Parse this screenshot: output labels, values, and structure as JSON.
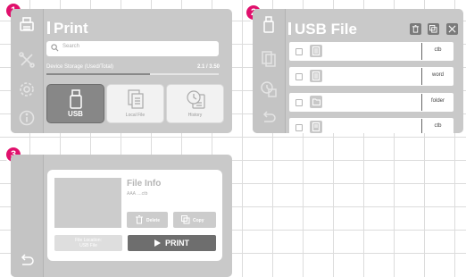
{
  "badges": [
    "1",
    "2",
    "3"
  ],
  "print_screen": {
    "title": "Print",
    "search_placeholder": "Search",
    "storage_label": "Device Storage (Used/Total)",
    "storage_value": "2.1 / 3.50",
    "storage_used_fraction": 0.6,
    "tiles": [
      {
        "label": "USB",
        "icon": "usb-drive-icon",
        "active": true
      },
      {
        "label": "Local File",
        "icon": "document-icon",
        "active": false
      },
      {
        "label": "History",
        "icon": "history-clock-icon",
        "active": false
      }
    ]
  },
  "usb_screen": {
    "title": "USB File",
    "header_icons": [
      "trash-icon",
      "copy-icon",
      "close-icon"
    ],
    "rows": [
      {
        "icon": "document-icon",
        "ext": "ctb"
      },
      {
        "icon": "document-icon",
        "ext": "word"
      },
      {
        "icon": "folder-icon",
        "ext": "folder"
      },
      {
        "icon": "document-icon",
        "ext": "ctb"
      }
    ]
  },
  "file_info_screen": {
    "title": "File Info",
    "file_name": "AAA ....ctb",
    "delete_label": "Delete",
    "copy_label": "Copy",
    "file_location_line1": "File Location:",
    "file_location_line2": "USB File",
    "print_label": "PRINT"
  },
  "colors": {
    "badge": "#e0106c",
    "panel": "#c9c9c9",
    "active_tile": "#878787",
    "print_button": "#6e6e6e"
  }
}
